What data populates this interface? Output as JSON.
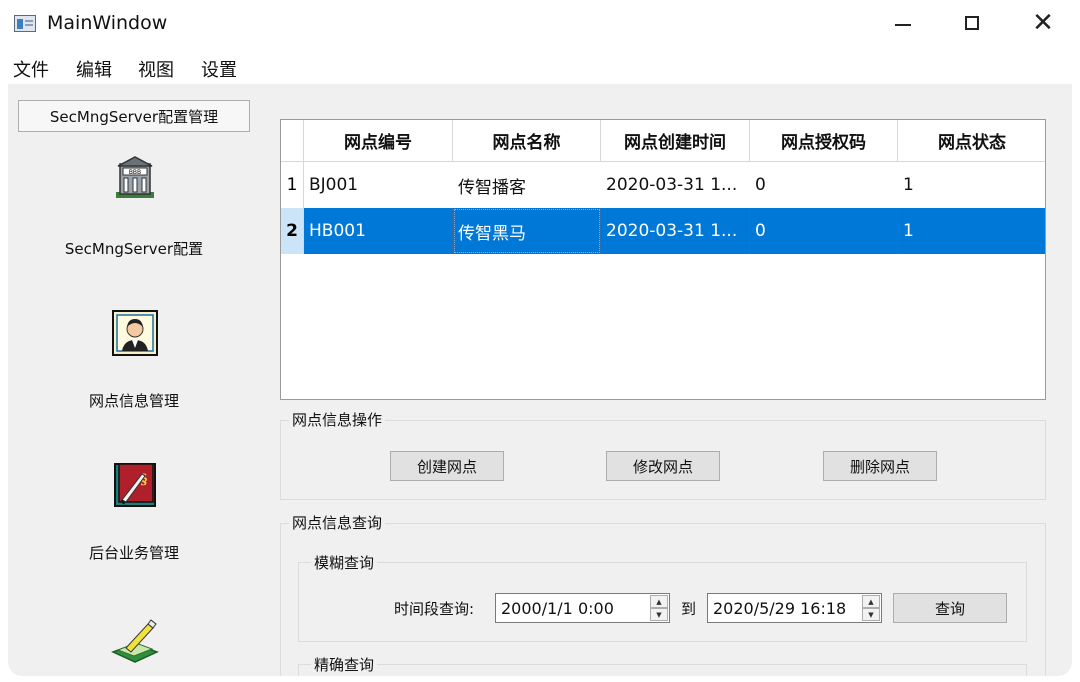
{
  "window": {
    "title": "MainWindow"
  },
  "menu": [
    "文件",
    "编辑",
    "视图",
    "设置"
  ],
  "nav": {
    "header_button": "SecMngServer配置管理",
    "items": [
      {
        "label": "SecMngServer配置",
        "icon": "building-icon"
      },
      {
        "label": "网点信息管理",
        "icon": "person-portrait-icon"
      },
      {
        "label": "后台业务管理",
        "icon": "book-quill-icon"
      },
      {
        "label": "",
        "icon": "pen-paper-icon"
      }
    ]
  },
  "table": {
    "columns": [
      "网点编号",
      "网点名称",
      "网点创建时间",
      "网点授权码",
      "网点状态"
    ],
    "rows": [
      {
        "num": "1",
        "cells": [
          "BJ001",
          "传智播客",
          "2020-03-31 1...",
          "0",
          "1"
        ],
        "selected": false
      },
      {
        "num": "2",
        "cells": [
          "HB001",
          "传智黑马",
          "2020-03-31 1...",
          "0",
          "1"
        ],
        "selected": true
      }
    ]
  },
  "ops_group": {
    "title": "网点信息操作",
    "buttons": [
      "创建网点",
      "修改网点",
      "删除网点"
    ]
  },
  "query_group": {
    "title": "网点信息查询",
    "fuzzy": {
      "title": "模糊查询",
      "time_label": "时间段查询:",
      "from_value": "2000/1/1 0:00",
      "to_label": "到",
      "to_value": "2020/5/29 16:18",
      "query_button": "查询"
    },
    "exact": {
      "title": "精确查询"
    }
  },
  "colors": {
    "selection": "#0078d7",
    "client_bg": "#f0f0f0"
  }
}
